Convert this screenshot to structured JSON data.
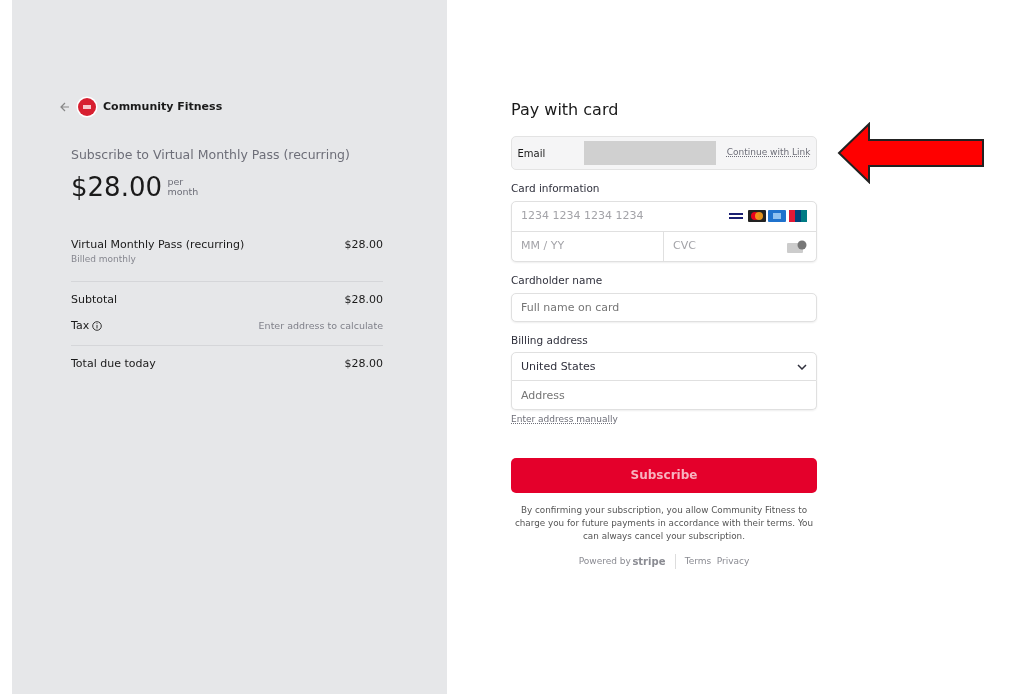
{
  "merchant": {
    "name": "Community Fitness"
  },
  "summary": {
    "title": "Subscribe to Virtual Monthly Pass (recurring)",
    "price": "$28.00",
    "period_top": "per",
    "period_bottom": "month"
  },
  "line_items": [
    {
      "name": "Virtual Monthly Pass (recurring)",
      "note": "Billed monthly",
      "amount": "$28.00"
    }
  ],
  "totals": [
    {
      "kind": "subtotal",
      "label": "Subtotal",
      "value": "$28.00",
      "info": false
    },
    {
      "kind": "tax",
      "label": "Tax",
      "value": "Enter address to calculate",
      "info": true
    },
    {
      "kind": "total",
      "label": "Total due today",
      "value": "$28.00",
      "info": false
    }
  ],
  "form": {
    "title": "Pay with card",
    "email": {
      "label": "Email",
      "link": "Continue with Link"
    },
    "card": {
      "label": "Card information",
      "number_placeholder": "1234 1234 1234 1234",
      "expiry_placeholder": "MM / YY",
      "cvc_placeholder": "CVC"
    },
    "cardholder": {
      "label": "Cardholder name",
      "placeholder": "Full name on card"
    },
    "billing": {
      "label": "Billing address",
      "country": "United States",
      "address_placeholder": "Address",
      "manual_link": "Enter address manually"
    },
    "submit": "Subscribe",
    "terms": "By confirming your subscription, you allow Community Fitness to charge you for future payments in accordance with their terms. You can always cancel your subscription.",
    "footer": {
      "powered": "Powered by",
      "brand": "stripe",
      "links": [
        "Terms",
        "Privacy"
      ]
    }
  }
}
